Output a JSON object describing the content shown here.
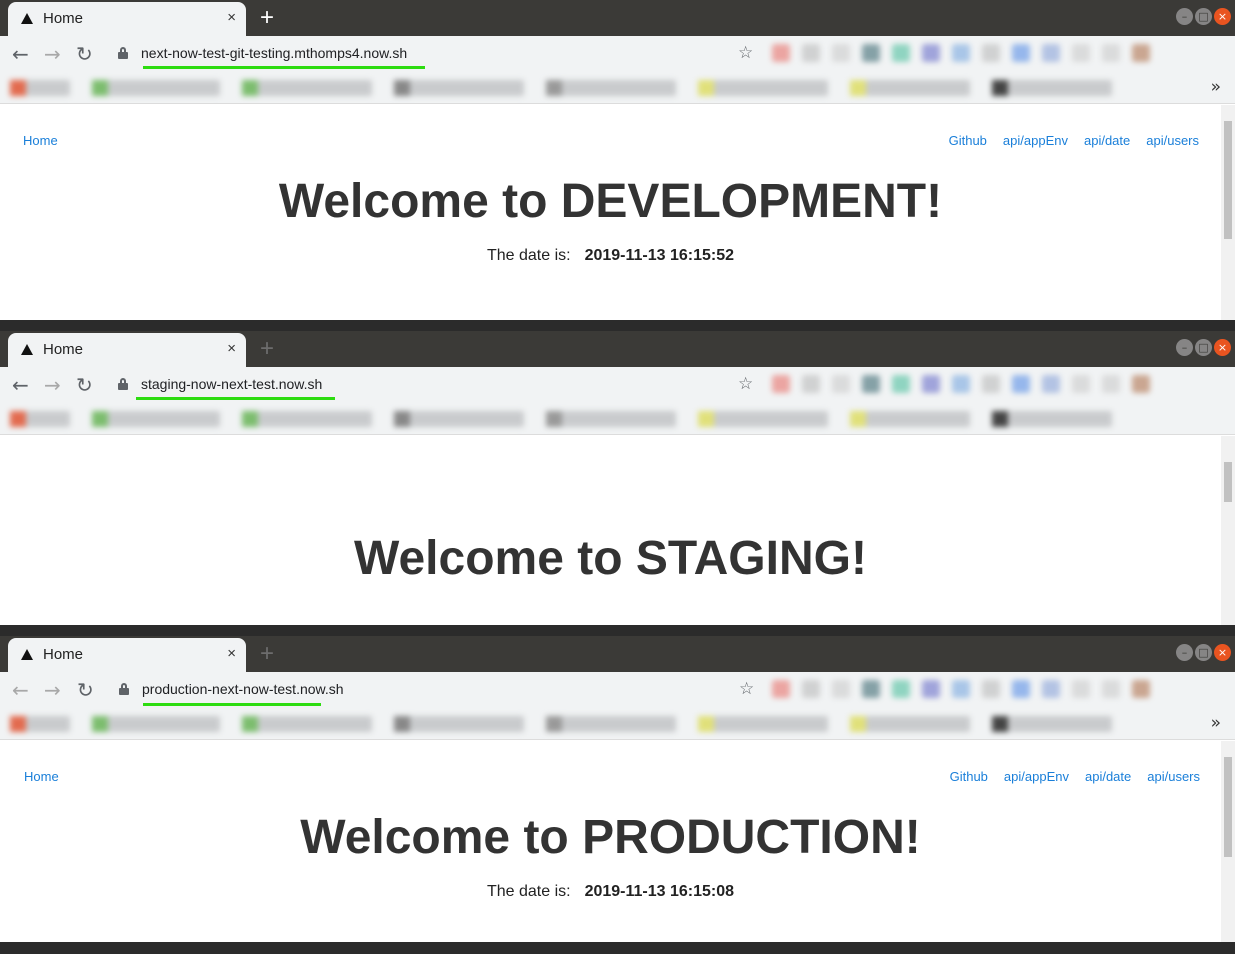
{
  "windows": [
    {
      "tab_title": "Home",
      "url": "next-now-test-git-testing.mthomps4.now.sh",
      "nav_home": "Home",
      "nav_links": [
        "Github",
        "api/appEnv",
        "api/date",
        "api/users"
      ],
      "heading": "Welcome to DEVELOPMENT!",
      "date_label": "The date is:",
      "date_value": "2019-11-13 16:15:52"
    },
    {
      "tab_title": "Home",
      "url": "staging-now-next-test.now.sh",
      "heading": "Welcome to STAGING!"
    },
    {
      "tab_title": "Home",
      "url": "production-next-now-test.now.sh",
      "nav_home": "Home",
      "nav_links": [
        "Github",
        "api/appEnv",
        "api/date",
        "api/users"
      ],
      "heading": "Welcome to PRODUCTION!",
      "date_label": "The date is:",
      "date_value": "2019-11-13 16:15:08"
    }
  ],
  "icons": {
    "close": "×",
    "new_tab": "+",
    "back": "←",
    "forward": "→",
    "reload": "↻",
    "star": "☆",
    "chevron": "»",
    "minimize": "–",
    "maximize": "□",
    "window_close": "×"
  },
  "colors": {
    "link": "#1a7fd9",
    "highlight_underline": "#2ddc10",
    "titlebar": "#3b3a37",
    "close_button": "#e95420"
  }
}
